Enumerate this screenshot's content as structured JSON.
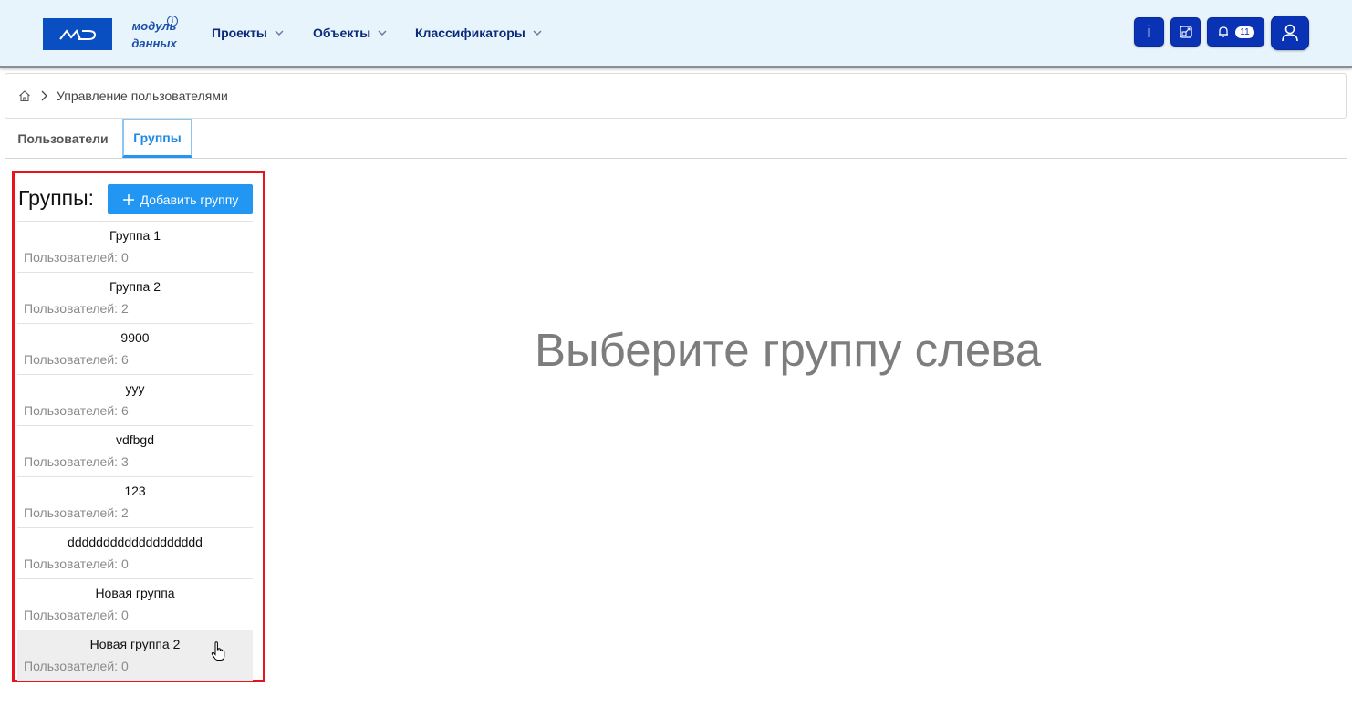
{
  "header": {
    "logo_line1": "модуль",
    "logo_line2": "данных",
    "logo_info": "i",
    "nav": [
      {
        "label": "Проекты"
      },
      {
        "label": "Объекты"
      },
      {
        "label": "Классификаторы"
      }
    ],
    "info_button_label": "i",
    "notifications_count": "11",
    "accent": "#0a32b5"
  },
  "breadcrumb": {
    "current": "Управление пользователями"
  },
  "tabs": [
    {
      "label": "Пользователи",
      "active": false
    },
    {
      "label": "Группы",
      "active": true
    }
  ],
  "groups": {
    "title": "Группы:",
    "add_button": "Добавить группу",
    "items": [
      {
        "name": "Группа 1",
        "count": "Пользователей: 0"
      },
      {
        "name": "Группа 2",
        "count": "Пользователей: 2"
      },
      {
        "name": "9900",
        "count": "Пользователей: 6"
      },
      {
        "name": "yyy",
        "count": "Пользователей: 6"
      },
      {
        "name": "vdfbgd",
        "count": "Пользователей: 3"
      },
      {
        "name": "123",
        "count": "Пользователей: 2"
      },
      {
        "name": "ddddddddddddddddddd",
        "count": "Пользователей: 0"
      },
      {
        "name": "Новая группа",
        "count": "Пользователей: 0"
      },
      {
        "name": "Новая группа 2",
        "count": "Пользователей: 0"
      }
    ]
  },
  "placeholder": "Выберите группу слева"
}
